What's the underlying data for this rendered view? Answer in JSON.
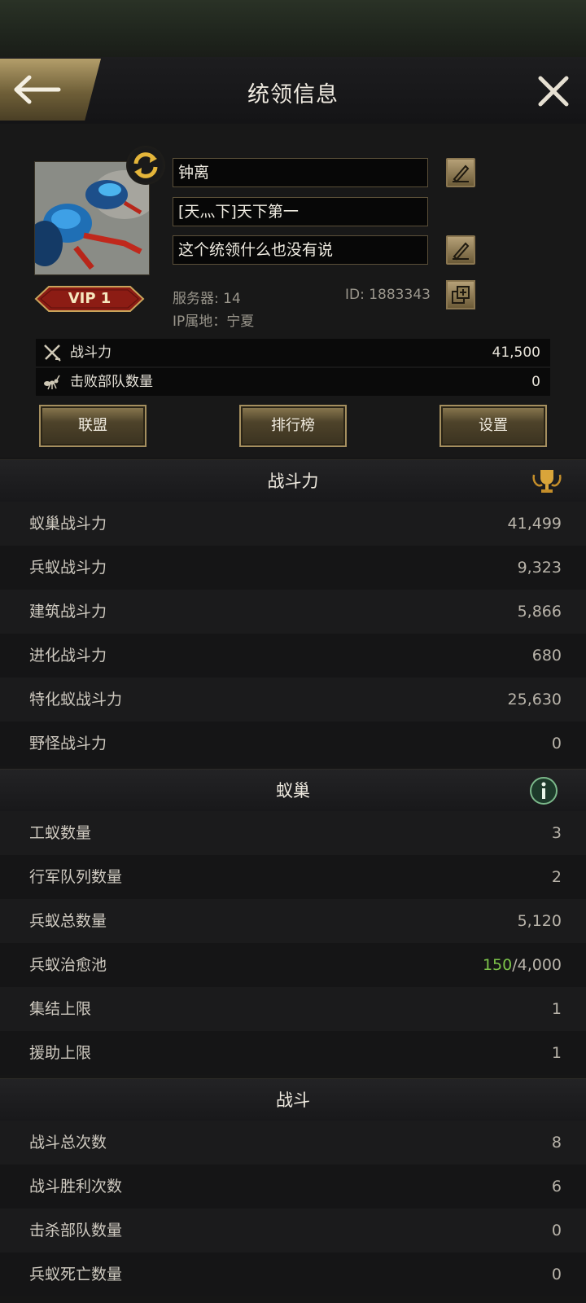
{
  "header": {
    "title": "统领信息"
  },
  "profile": {
    "name": "钟离",
    "alliance_tag": "[天灬下]天下第一",
    "signature": "这个统领什么也没有说",
    "vip": "VIP 1",
    "server": "服务器: 14",
    "id": "ID: 1883343",
    "ip": "IP属地：宁夏"
  },
  "stats": [
    {
      "label": "战斗力",
      "value": "41,500",
      "icon": "crossed-swords-icon"
    },
    {
      "label": "击败部队数量",
      "value": "0",
      "icon": "ant-icon"
    }
  ],
  "buttons": {
    "alliance": "联盟",
    "ranking": "排行榜",
    "settings": "设置"
  },
  "sections": {
    "power": {
      "title": "战斗力",
      "rows": [
        {
          "label": "蚁巢战斗力",
          "value": "41,499"
        },
        {
          "label": "兵蚁战斗力",
          "value": "9,323"
        },
        {
          "label": "建筑战斗力",
          "value": "5,866"
        },
        {
          "label": "进化战斗力",
          "value": "680"
        },
        {
          "label": "特化蚁战斗力",
          "value": "25,630"
        },
        {
          "label": "野怪战斗力",
          "value": "0"
        }
      ]
    },
    "nest": {
      "title": "蚁巢",
      "rows": [
        {
          "label": "工蚁数量",
          "value": "3"
        },
        {
          "label": "行军队列数量",
          "value": "2"
        },
        {
          "label": "兵蚁总数量",
          "value": "5,120"
        },
        {
          "label": "兵蚁治愈池",
          "value_current": "150",
          "value_max": "/4,000"
        },
        {
          "label": "集结上限",
          "value": "1"
        },
        {
          "label": "援助上限",
          "value": "1"
        }
      ]
    },
    "battle": {
      "title": "战斗",
      "rows": [
        {
          "label": "战斗总次数",
          "value": "8"
        },
        {
          "label": "战斗胜利次数",
          "value": "6"
        },
        {
          "label": "击杀部队数量",
          "value": "0"
        },
        {
          "label": "兵蚁死亡数量",
          "value": "0"
        }
      ]
    }
  },
  "colors": {
    "gold": "#b39e6a",
    "accent_green": "#7cc24a",
    "vip_red": "#8c1c14"
  }
}
